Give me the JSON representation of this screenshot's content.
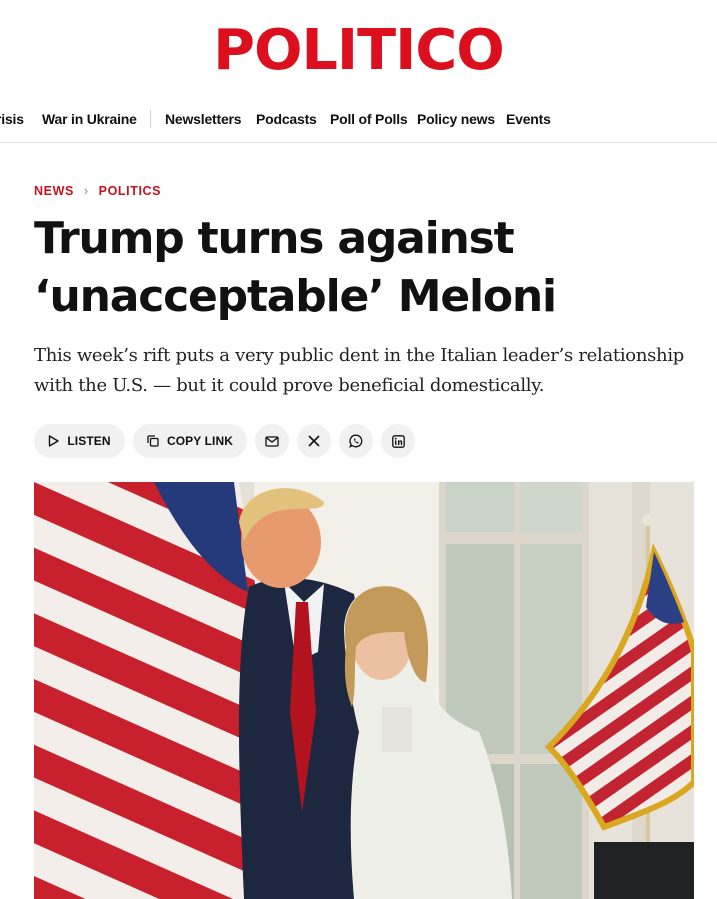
{
  "site": {
    "logo": "POLITICO"
  },
  "nav": {
    "items": [
      {
        "label": "risis"
      },
      {
        "label": "War in Ukraine"
      },
      {
        "label": "Newsletters"
      },
      {
        "label": "Podcasts"
      },
      {
        "label": "Poll of Polls"
      },
      {
        "label": "Policy news"
      },
      {
        "label": "Events"
      }
    ]
  },
  "breadcrumb": {
    "section": "NEWS",
    "subsection": "POLITICS"
  },
  "article": {
    "headline_line1": "Trump turns against",
    "headline_line2": "‘unacceptable’ Meloni",
    "dek": "This week’s rift puts a very public dent in the Italian leader’s relationship with the U.S. — but it could prove beneficial domestically."
  },
  "actions": {
    "listen": {
      "label": "LISTEN",
      "icon": "play-icon"
    },
    "copy_link": {
      "label": "COPY LINK",
      "icon": "copy-icon"
    },
    "share": [
      {
        "name": "email",
        "icon": "mail-icon"
      },
      {
        "name": "x",
        "icon": "x-icon"
      },
      {
        "name": "whatsapp",
        "icon": "whatsapp-icon"
      },
      {
        "name": "linkedin",
        "icon": "linkedin-icon"
      }
    ]
  },
  "colors": {
    "brand_red": "#dc0f1e",
    "crumb_red": "#c8101e",
    "pill_bg": "#f1f1f1"
  }
}
